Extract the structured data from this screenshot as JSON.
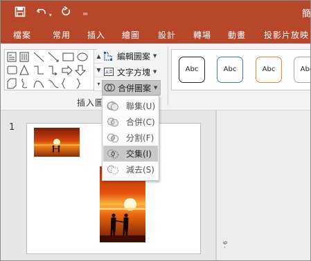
{
  "titlebar": {
    "title_fragment": "簡",
    "qa_menu_glyph": "="
  },
  "tabs": [
    {
      "label": "檔案"
    },
    {
      "label": "常用"
    },
    {
      "label": "插入"
    },
    {
      "label": "繪圖"
    },
    {
      "label": "設計"
    },
    {
      "label": "轉場"
    },
    {
      "label": "動畫"
    },
    {
      "label": "投影片放映"
    }
  ],
  "ribbon": {
    "commands": {
      "edit_shape": "編輯圖案",
      "text_box": "文字方塊",
      "merge_shapes": "合併圖案"
    },
    "group_label": "插入圖案",
    "styles": [
      "Abc",
      "Abc",
      "Abc",
      "Abc"
    ],
    "gallery_scroll": [
      "▲",
      "▼",
      "▾"
    ]
  },
  "merge_menu": [
    {
      "label": "聯集(U)"
    },
    {
      "label": "合併(C)"
    },
    {
      "label": "分割(F)"
    },
    {
      "label": "交集(I)"
    },
    {
      "label": "減去(S)"
    }
  ],
  "slides": {
    "number": "1"
  },
  "ruler": {
    "label": "9 -"
  },
  "colors": {
    "accent": "#b7472a",
    "ribbon_bg": "#f3f3f3",
    "highlight": "#c8c8c8"
  }
}
